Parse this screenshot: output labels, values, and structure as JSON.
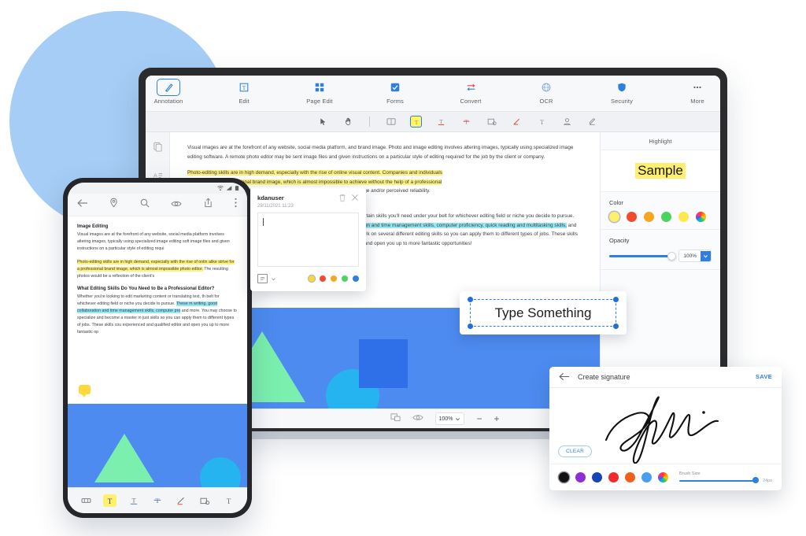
{
  "app": {
    "ribbon": [
      {
        "label": "Annotation",
        "icon": "annotation-icon",
        "active": true
      },
      {
        "label": "Edit",
        "icon": "edit-icon",
        "active": false
      },
      {
        "label": "Page Edit",
        "icon": "page-edit-icon",
        "active": false
      },
      {
        "label": "Forms",
        "icon": "forms-icon",
        "active": false
      },
      {
        "label": "Convert",
        "icon": "convert-icon",
        "active": false
      },
      {
        "label": "OCR",
        "icon": "ocr-icon",
        "active": false
      },
      {
        "label": "Security",
        "icon": "security-icon",
        "active": false
      },
      {
        "label": "More",
        "icon": "more-icon",
        "active": false
      }
    ],
    "annotation_tools": [
      {
        "name": "select-cursor-tool"
      },
      {
        "name": "hand-tool"
      },
      {
        "name": "sticky-note-tool"
      },
      {
        "name": "highlight-text-tool",
        "selected": true
      },
      {
        "name": "underline-text-tool"
      },
      {
        "name": "strikethrough-text-tool"
      },
      {
        "name": "shape-tool"
      },
      {
        "name": "pen-tool"
      },
      {
        "name": "text-box-tool"
      },
      {
        "name": "stamp-tool"
      },
      {
        "name": "eraser-tool"
      }
    ],
    "left_rail": [
      {
        "name": "page-thumbnails-icon"
      },
      {
        "name": "outline-icon"
      }
    ],
    "status_bar": {
      "page_layout_icon": "page-layout-icon",
      "view_icon": "eye-icon",
      "zoom_value": "100%",
      "zoom_out": "−",
      "zoom_in": "+"
    }
  },
  "document": {
    "paragraph1": "Visual images are at the forefront of any website, social media platform, and brand image. Photo and image editing involves altering images, typically using specialized image editing software. A remote photo editor may be sent image files and given instructions on a particular style of editing required for the job by the client or company.",
    "highlighted_line1": "Photo-editing skills are in high demand, especially with the rise of online visual content. Companies and individuals",
    "highlighted_line2": "alike strive for a professional brand image, which is almost impossible to achieve without the help of a professional",
    "highlighted_line3": "photo editor.",
    "paragraph2_tail": " The resulting photos would be a reflection of the client's brand image and/or perceived reliability.",
    "heading2": "What Editing Skills Do You Need to Be a Professional Editor?",
    "paragraph3_pre": "Whether you're looking to edit marketing content or translating text, there are certain skills you'll need under your belt for whichever editing field or niche you decide to pursue. ",
    "cyan_highlight": "These may include an advanced degree in language or writing, good collaboration and time management skills, computer proficiency, quick reading and multitasking skills,",
    "paragraph3_post": " and more. You may choose to specialize and become a master in just one skill or work on several different editing skills so you can apply them to different types of jobs. These skills could be instrumental in proving that you're an experienced and qualified editor and open you up to more fantastic opportunities!"
  },
  "comment_popup": {
    "user": "kdanuser",
    "timestamp": "29/11/2021  11:23",
    "body_text": "",
    "delete_icon": "trash-icon",
    "close_icon": "close-icon",
    "note_icon": "note-type-icon",
    "colors": [
      "#f5d93a",
      "#ef4b2d",
      "#f5a623",
      "#4cd35e",
      "#2f7fe0"
    ],
    "selected_color_index": 0
  },
  "text_box": {
    "value": "Type Something"
  },
  "highlight_panel": {
    "title": "Highlight",
    "sample_text": "Sample",
    "sample_highlight_color": "#ffef6e",
    "color_label": "Color",
    "colors": [
      "#ffef6e",
      "#ef4b2d",
      "#f5a623",
      "#4cd35e",
      "#ffe84d",
      "rainbow"
    ],
    "selected_color_index": 0,
    "opacity_label": "Opacity",
    "opacity_value": "100%",
    "opacity_percent": 100
  },
  "phone": {
    "status_icons": [
      "wifi-icon",
      "signal-icon",
      "battery-icon"
    ],
    "toolbar": [
      {
        "name": "back-arrow-icon"
      },
      {
        "name": "bookmark-icon"
      },
      {
        "name": "search-icon"
      },
      {
        "name": "view-eye-icon"
      },
      {
        "name": "share-icon"
      },
      {
        "name": "more-vertical-icon"
      }
    ],
    "heading1": "Image Editing",
    "paragraph1": "Visual images are at the forefront of any website, social media platform involves altering images, typically using specialized image editing soft image files and given instructions on a particular style of editing requi",
    "highlight1": "Photo-editing skills are in high demand, especially with the rise of onlin alike strive for a professional brand image, which is almost impossible photo editor.",
    "highlight1_tail": " The resulting photos would be a reflection of the client's",
    "heading2": "What Editing Skills Do You Need to Be a Professional Editor?",
    "paragraph2_pre": "Whether you're looking to edit marketing content or translating text, th belt for whichever editing field or niche you decide to pursue. ",
    "cyan_highlight": "These m writing, good collaboration and time management skills, computer pro",
    "paragraph2_post": " and more. You may choose to specialize and become a master in just skills so you can apply them to different types of jobs. These skills cou experienced and qualified editor and open you up to more fantastic op",
    "bottom_tools": [
      {
        "name": "marker-tool"
      },
      {
        "name": "highlight-text-tool",
        "selected": true
      },
      {
        "name": "underline-text-tool"
      },
      {
        "name": "strikethrough-text-tool"
      },
      {
        "name": "pen-tool"
      },
      {
        "name": "shape-tool"
      },
      {
        "name": "text-tool"
      }
    ]
  },
  "signature_panel": {
    "back_icon": "back-arrow-icon",
    "title": "Create signature",
    "save_label": "SAVE",
    "clear_label": "CLEAR",
    "colors": [
      "#121212",
      "#8e2fd6",
      "#1546b8",
      "#ef2b2b",
      "#f0601a",
      "#4b9df0",
      "rainbow"
    ],
    "selected_color_index": 0,
    "brush_label": "Brush Size",
    "brush_value": "24px",
    "brush_percent": 100
  },
  "theme": {
    "accent": "#2f7fe0",
    "background_circle": "#a6cdf5",
    "highlight_yellow": "#fff27a",
    "highlight_cyan": "#96e8f7",
    "illustration_blue": "#4d8bf0",
    "illustration_green": "#7bf0ae",
    "illustration_cyan": "#26b4f0"
  }
}
